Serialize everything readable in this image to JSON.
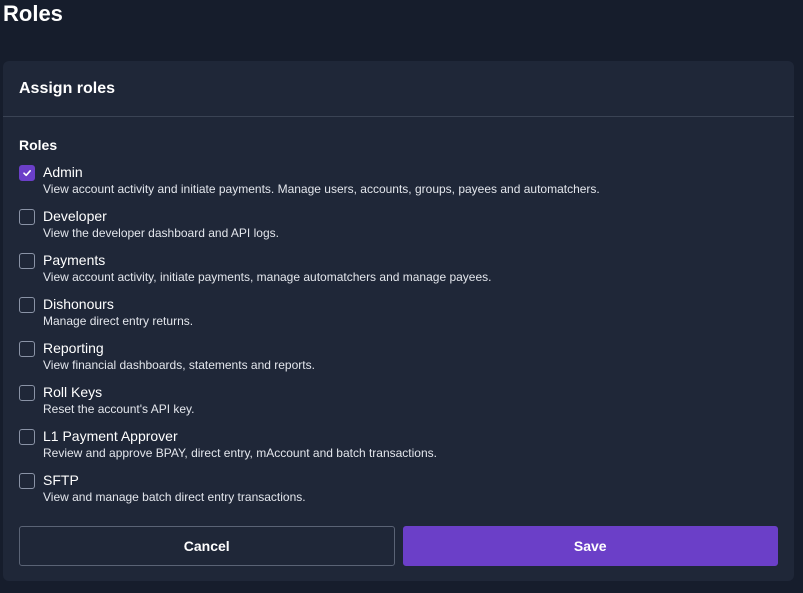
{
  "page": {
    "title": "Roles"
  },
  "card": {
    "title": "Assign roles",
    "section_label": "Roles"
  },
  "roles": [
    {
      "name": "Admin",
      "description": "View account activity and initiate payments. Manage users, accounts, groups, payees and automatchers.",
      "checked": true
    },
    {
      "name": "Developer",
      "description": "View the developer dashboard and API logs.",
      "checked": false
    },
    {
      "name": "Payments",
      "description": "View account activity, initiate payments, manage automatchers and manage payees.",
      "checked": false
    },
    {
      "name": "Dishonours",
      "description": "Manage direct entry returns.",
      "checked": false
    },
    {
      "name": "Reporting",
      "description": "View financial dashboards, statements and reports.",
      "checked": false
    },
    {
      "name": "Roll Keys",
      "description": "Reset the account's API key.",
      "checked": false
    },
    {
      "name": "L1 Payment Approver",
      "description": "Review and approve BPAY, direct entry, mAccount and batch transactions.",
      "checked": false
    },
    {
      "name": "SFTP",
      "description": "View and manage batch direct entry transactions.",
      "checked": false
    }
  ],
  "actions": {
    "cancel_label": "Cancel",
    "save_label": "Save"
  },
  "colors": {
    "accent": "#6b3fc8",
    "background": "#161d2c",
    "card": "#1f2738"
  }
}
